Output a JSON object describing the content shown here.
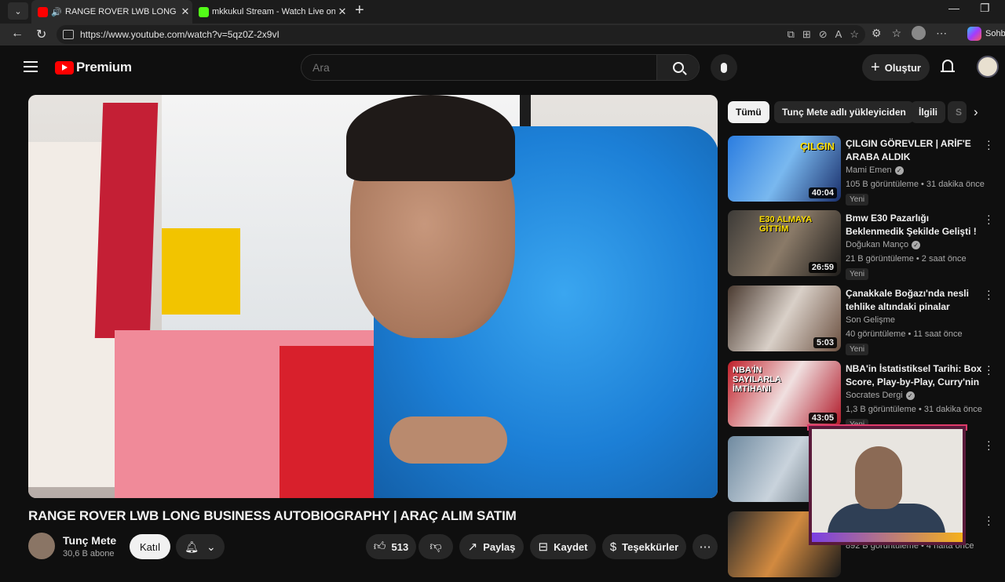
{
  "browser": {
    "tabs": [
      {
        "title": "RANGE ROVER LWB LONG BUSINESS AUTOBIOGRAPHY",
        "favicon_color": "#ff0000",
        "active": true
      },
      {
        "title": "mkkukul Stream - Watch Live on Kick",
        "favicon_color": "#53fc18",
        "active": false
      }
    ],
    "url": "https://www.youtube.com/watch?v=5qz0Z-2x9vI",
    "profile_label": "Sohb"
  },
  "yt": {
    "logo_text": "Premium",
    "search_placeholder": "Ara",
    "create_label": "Oluştur"
  },
  "video": {
    "title": "RANGE ROVER LWB LONG BUSINESS AUTOBIOGRAPHY | ARAÇ ALIM SATIM",
    "channel": "Tunç Mete",
    "subscribers": "30,6 B abone",
    "join_label": "Katıl",
    "likes": "513",
    "share_label": "Paylaş",
    "save_label": "Kaydet",
    "thanks_label": "Teşekkürler"
  },
  "chips": [
    "Tümü",
    "Tunç Mete adlı yükleyiciden",
    "İlgili",
    "S"
  ],
  "recommendations": [
    {
      "title": "ÇILGIN GÖREVLER | ARİF'E ARABA ALDIK",
      "channel": "Mami Emen",
      "verified": true,
      "views": "105 B görüntüleme • 31 dakika önce",
      "duration": "40:04",
      "badge": "Yeni",
      "thumb_text": "ÇILGIN"
    },
    {
      "title": "Bmw E30 Pazarlığı Beklenmedik Şekilde Gelişti !",
      "channel": "Doğukan Manço",
      "verified": true,
      "views": "21 B görüntüleme • 2 saat önce",
      "duration": "26:59",
      "badge": "Yeni",
      "thumb_text": "E30 ALMAYA GİTTİM"
    },
    {
      "title": "Çanakkale Boğazı'nda nesli tehlike altındaki pinalar yenide...",
      "channel": "Son Gelişme",
      "verified": false,
      "views": "40 görüntüleme • 11 saat önce",
      "duration": "5:03",
      "badge": "Yeni",
      "thumb_text": ""
    },
    {
      "title": "NBA'in İstatistiksel Tarihi: Box Score, Play-by-Play, Curry'nin ...",
      "channel": "Socrates Dergi",
      "verified": true,
      "views": "1,3 B görüntüleme • 31 dakika önce",
      "duration": "43:05",
      "badge": "Yeni",
      "thumb_text": "NBA'İN SAYILARLA İMTİHANI"
    },
    {
      "title": "",
      "channel": "",
      "verified": false,
      "views": "",
      "duration": "",
      "badge": "",
      "thumb_text": ""
    },
    {
      "title": "",
      "channel": "",
      "verified": false,
      "views": "892 B görüntüleme • 4 hafta önce",
      "duration": "",
      "badge": "",
      "thumb_text": ""
    }
  ]
}
